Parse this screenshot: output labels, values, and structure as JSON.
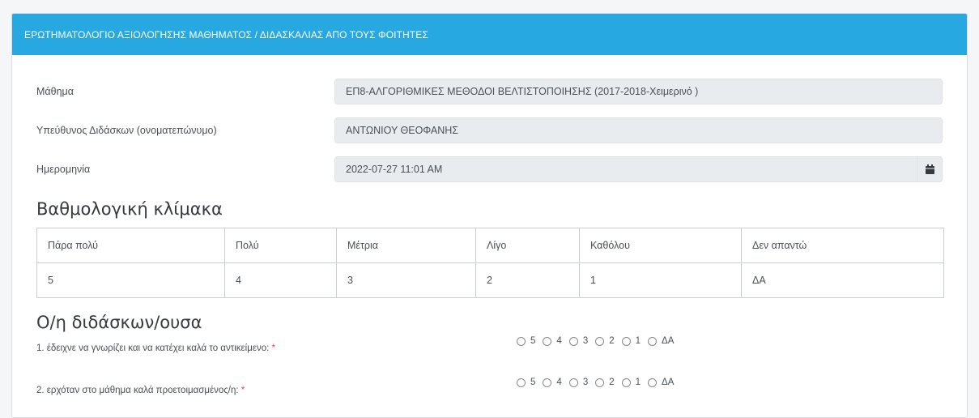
{
  "header": {
    "title": "ΕΡΩΤΗΜΑΤΟΛΟΓΙΟ ΑΞΙΟΛΟΓΗΣΗΣ ΜΑΘΗΜΑΤΟΣ / ΔΙΔΑΣΚΑΛΙΑΣ ΑΠΟ ΤΟΥΣ ΦΟΙΤΗΤΕΣ"
  },
  "fields": {
    "course_label": "Μάθημα",
    "course_value": "ΕΠ8-ΑΛΓΟΡΙΘΜΙΚΕΣ ΜΕΘΟΔΟΙ ΒΕΛΤΙΣΤΟΠΟΙΗΣΗΣ (2017-2018-Χειμερινό )",
    "instructor_label": "Υπεύθυνος Διδάσκων (ονοματεπώνυμο)",
    "instructor_value": "ΑΝΤΩΝΙΟΥ ΘΕΟΦΑΝΗΣ",
    "date_label": "Ημερομηνία",
    "date_value": "2022-07-27 11:01 AM",
    "date_icon": "calendar-icon"
  },
  "scale": {
    "title": "Βαθμολογική κλίμακα",
    "headers": [
      "Πάρα πολύ",
      "Πολύ",
      "Μέτρια",
      "Λίγο",
      "Καθόλου",
      "Δεν απαντώ"
    ],
    "values": [
      "5",
      "4",
      "3",
      "2",
      "1",
      "ΔΑ"
    ]
  },
  "instructor_section": {
    "title": "Ο/η διδάσκων/ουσα",
    "required_mark": "*",
    "options": [
      "5",
      "4",
      "3",
      "2",
      "1",
      "ΔΑ"
    ],
    "questions": [
      "1. έδειχνε να γνωρίζει και να κατέχει καλά το αντικείμενο:",
      "2. ερχόταν στο μάθημα καλά προετοιμασμένος/η:"
    ]
  }
}
